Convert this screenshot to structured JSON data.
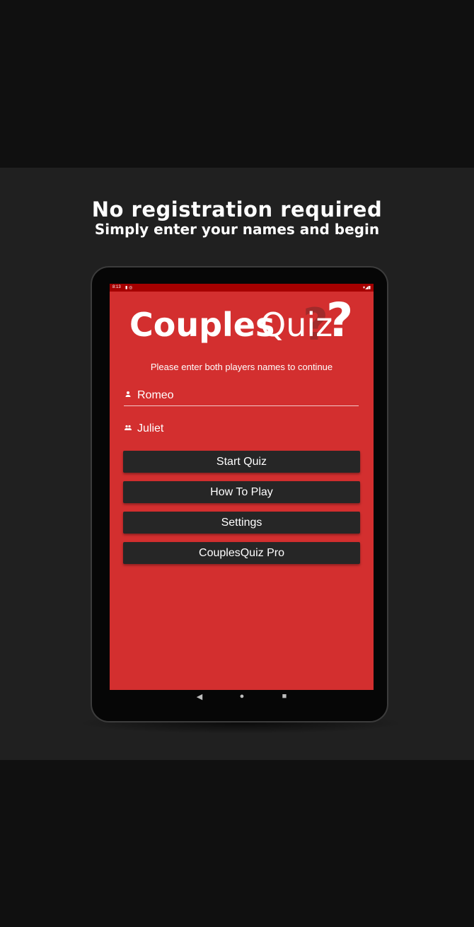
{
  "promo": {
    "headline": "No registration required",
    "subline": "Simply enter your names and begin"
  },
  "status_bar": {
    "time": "8:13",
    "left_icons": [
      "sim-card-icon",
      "notification-icon"
    ],
    "right_icons": [
      "wifi-icon",
      "signal-icon",
      "battery-icon"
    ]
  },
  "app": {
    "logo_part1": "Couples",
    "logo_part2": "Quiz",
    "logo_qmark": "?",
    "instruction": "Please enter both players names to continue",
    "player1": {
      "value": "Romeo",
      "icon": "person-icon"
    },
    "player2": {
      "value": "Juliet",
      "icon": "people-icon"
    },
    "buttons": {
      "start": "Start Quiz",
      "how_to_play": "How To Play",
      "settings": "Settings",
      "pro": "CouplesQuiz Pro"
    }
  },
  "nav_bar": {
    "back": "◀",
    "home": "●",
    "recent": "■"
  },
  "colors": {
    "app_background": "#d32f2f",
    "status_bar": "#a50000",
    "button_background": "#262626",
    "page_background": "#101010",
    "promo_background": "#202020"
  }
}
